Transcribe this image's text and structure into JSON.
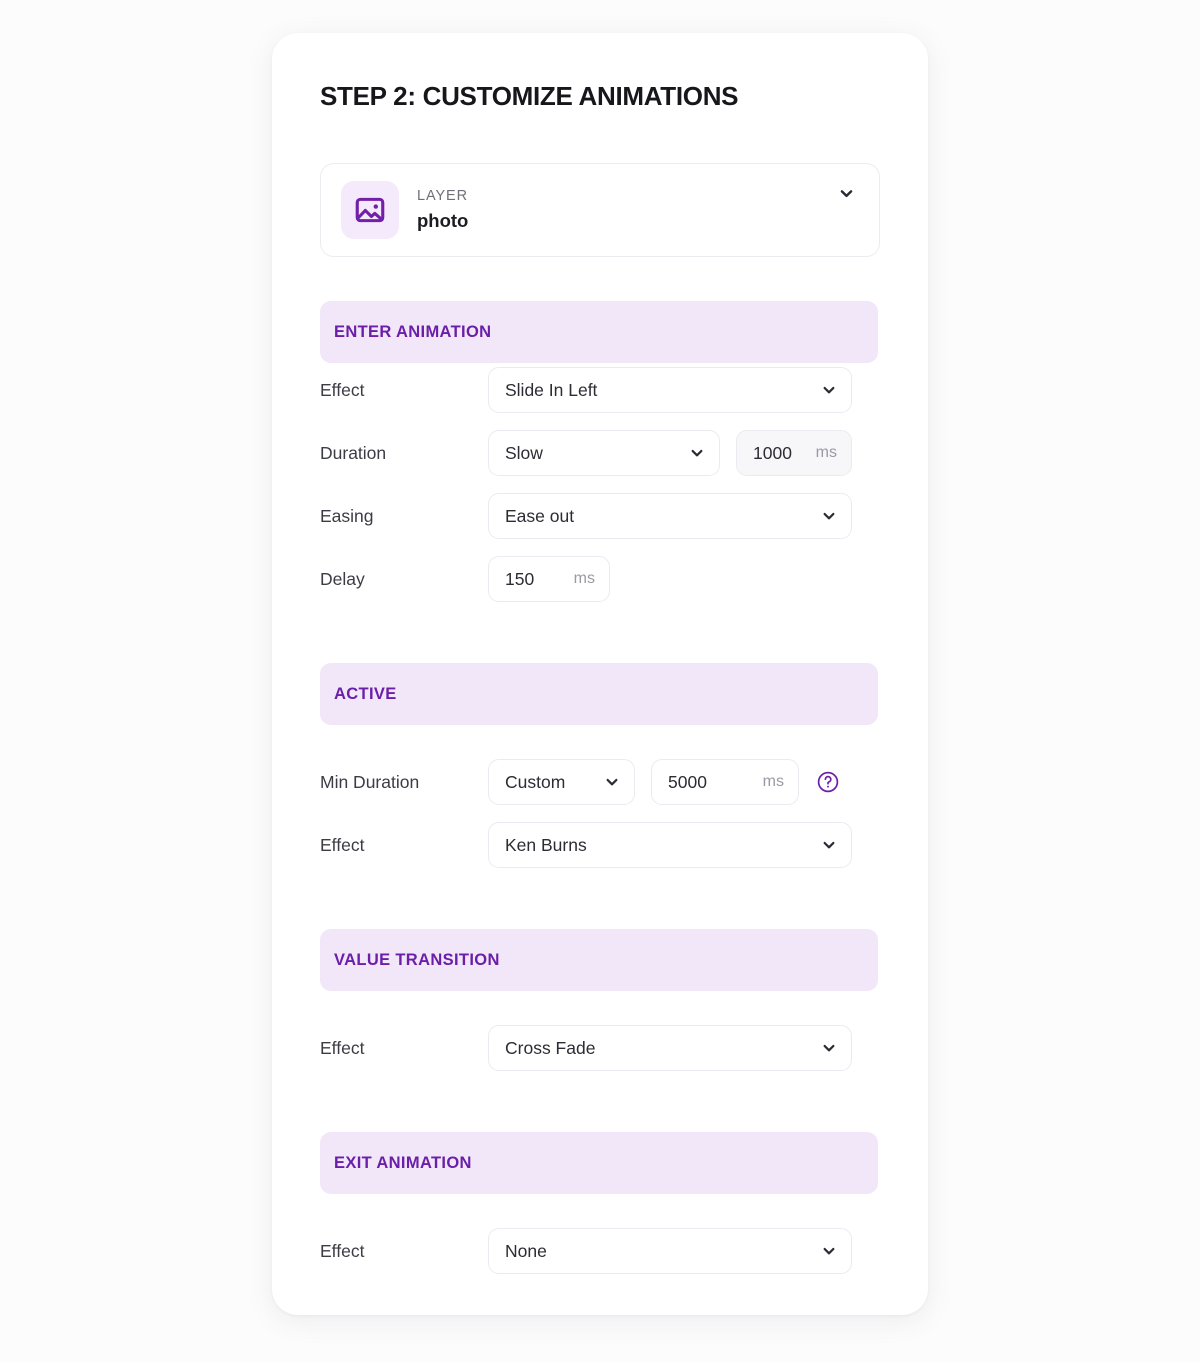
{
  "page": {
    "background_color": "#fcfcfc",
    "card_background": "#ffffff"
  },
  "theme": {
    "accent_purple": "#6b1fa8",
    "band_background": "#f1e7f8",
    "icon_tile_background": "#f4eafb",
    "label_color": "#3c3c46",
    "unit_color": "#9a9aa5"
  },
  "header": {
    "title": "STEP 2: CUSTOMIZE ANIMATIONS"
  },
  "layer_selector": {
    "icon": "image-icon",
    "kicker": "LAYER",
    "value": "photo",
    "chevron": "chevron-down-icon"
  },
  "sections": [
    {
      "id": "enter-animation",
      "band_label": "ENTER ANIMATION",
      "rows": [
        {
          "id": "enter-effect",
          "label": "Effect",
          "select_value": "Slide In Left"
        },
        {
          "id": "enter-duration",
          "label": "Duration",
          "select_value": "Slow",
          "number_value": "1000",
          "unit": "ms"
        },
        {
          "id": "enter-easing",
          "label": "Easing",
          "select_value": "Ease out"
        },
        {
          "id": "enter-delay",
          "label": "Delay",
          "number_value": "150",
          "unit": "ms"
        }
      ]
    },
    {
      "id": "active",
      "band_label": "ACTIVE",
      "rows": [
        {
          "id": "active-min-duration",
          "label": "Min Duration",
          "select_value": "Custom",
          "number_value": "5000",
          "unit": "ms",
          "help": "help-circle-icon"
        },
        {
          "id": "active-effect",
          "label": "Effect",
          "select_value": "Ken Burns"
        }
      ]
    },
    {
      "id": "value-transition",
      "band_label": "VALUE TRANSITION",
      "rows": [
        {
          "id": "value-transition-effect",
          "label": "Effect",
          "select_value": "Cross Fade"
        }
      ]
    },
    {
      "id": "exit-animation",
      "band_label": "EXIT ANIMATION",
      "rows": [
        {
          "id": "exit-effect",
          "label": "Effect",
          "select_value": "None"
        }
      ]
    }
  ]
}
